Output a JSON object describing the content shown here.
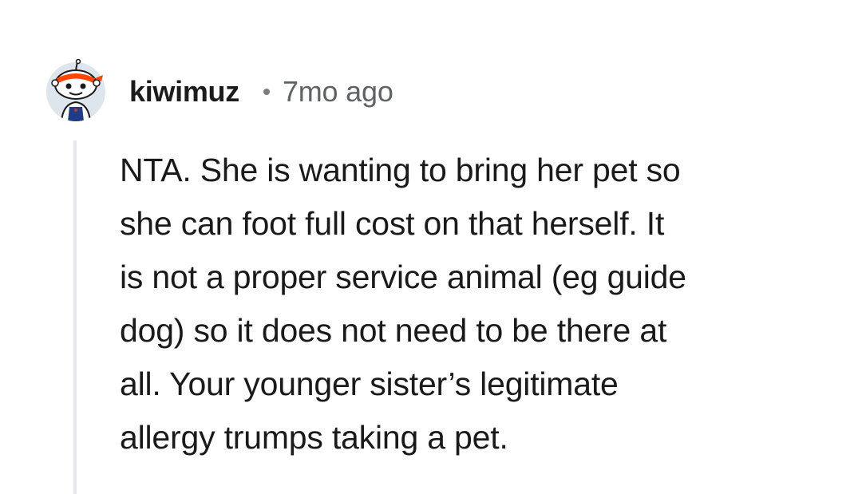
{
  "comment": {
    "author": "kiwimuz",
    "age": "7mo ago",
    "avatar_icon": "snoo-avatar-icon",
    "body_lines": [
      "NTA. She is wanting to bring her pet so",
      "she can foot full cost on that herself. It",
      "is not a proper service animal (eg guide",
      "dog) so it does not need to be there at",
      "all. Your younger sister’s legitimate",
      "allergy trumps taking a pet."
    ]
  },
  "colors": {
    "text": "#1a1a1b",
    "meta": "#5f6266",
    "thread_line": "#e4e6e8",
    "avatar_headband": "#ff4500"
  }
}
